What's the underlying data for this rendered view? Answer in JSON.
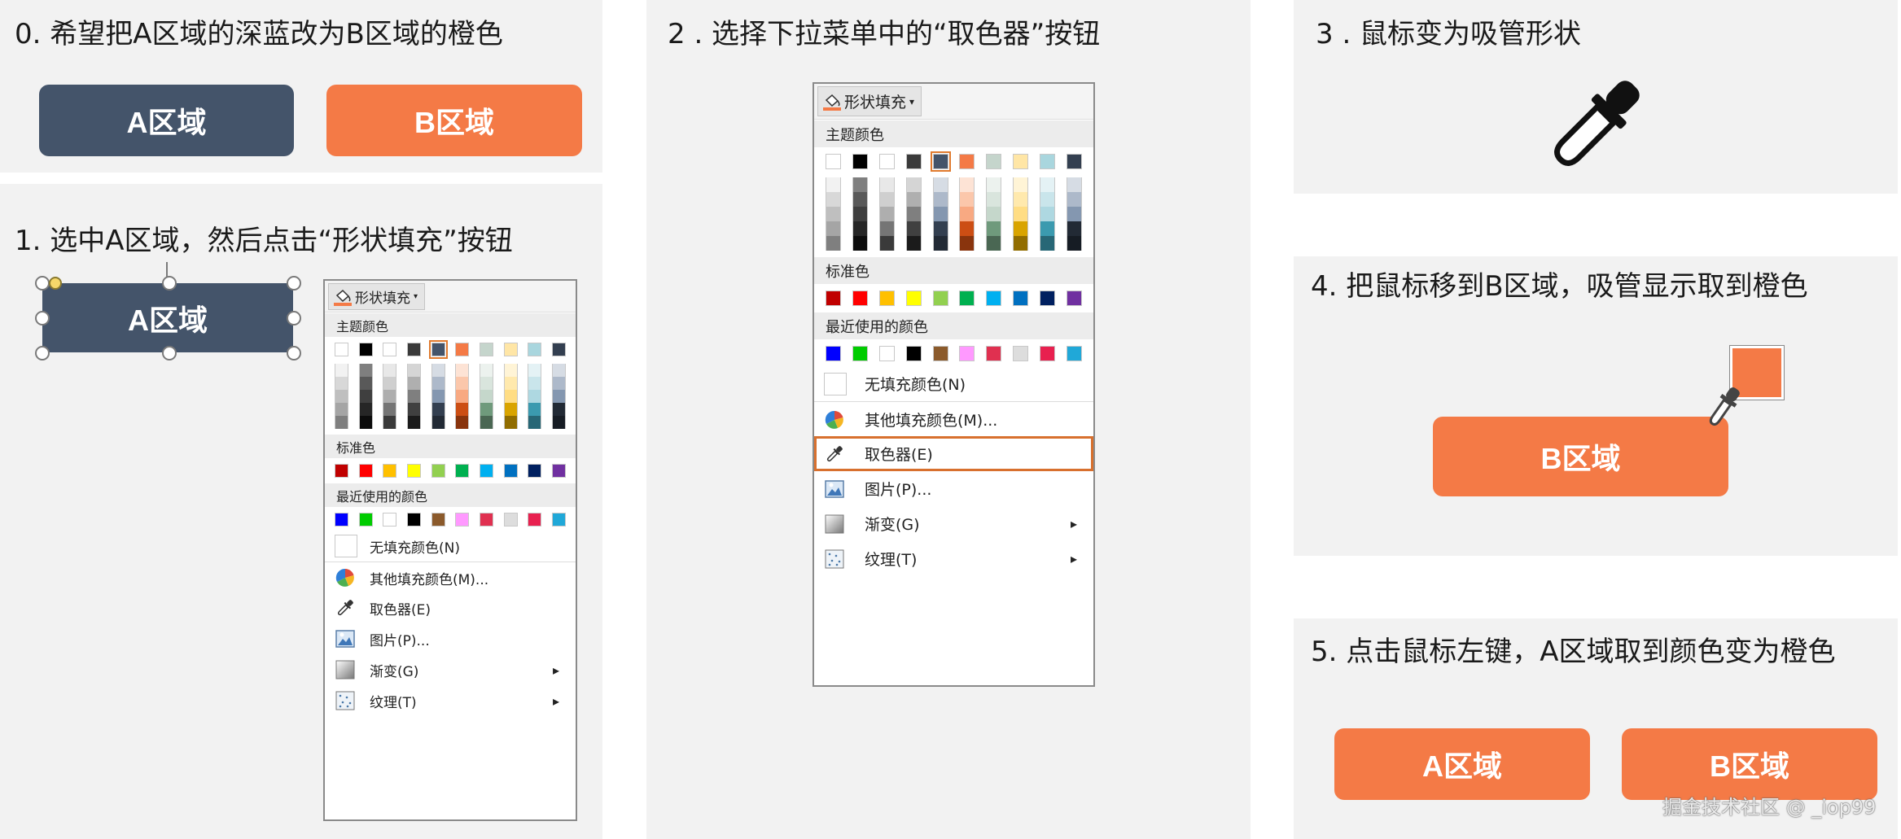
{
  "steps": {
    "s0": "0. 希望把A区域的深蓝改为B区域的橙色",
    "s1": "1. 选中A区域，然后点击“形状填充”按钮",
    "s2": "2 . 选择下拉菜单中的“取色器”按钮",
    "s3": "3 . 鼠标变为吸管形状",
    "s4": "4. 把鼠标移到B区域，吸管显示取到橙色",
    "s5": "5. 点击鼠标左键，A区域取到颜色变为橙色"
  },
  "shapes": {
    "a_label": "A区域",
    "b_label": "B区域"
  },
  "menu": {
    "button_label": "形状填充",
    "theme_colors_header": "主题颜色",
    "standard_colors_header": "标准色",
    "recent_colors_header": "最近使用的颜色",
    "no_fill": "无填充颜色(N)",
    "more_colors": "其他填充颜色(M)...",
    "eyedropper": "取色器(E)",
    "picture": "图片(P)...",
    "gradient": "渐变(G)",
    "texture": "纹理(T)",
    "theme_top": [
      "#ffffff",
      "#000000",
      "#ffffff",
      "#3a3a3a",
      "#44546a",
      "#f47a46",
      "#c5d5cc",
      "#ffe6a6",
      "#a9d6de",
      "#333f50"
    ],
    "theme_shades": [
      [
        "#f2f2f2",
        "#d8d8d8",
        "#bfbfbf",
        "#a5a5a5",
        "#7f7f7f"
      ],
      [
        "#7f7f7f",
        "#595959",
        "#3f3f3f",
        "#262626",
        "#0c0c0c"
      ],
      [
        "#e8e8e8",
        "#cfcfcf",
        "#aeaeae",
        "#757575",
        "#3a3a3a"
      ],
      [
        "#d5d5d5",
        "#afafaf",
        "#7f7f7f",
        "#404040",
        "#1b1b1b"
      ],
      [
        "#d6dce4",
        "#adb9ca",
        "#8497b0",
        "#333f50",
        "#222a35"
      ],
      [
        "#fde3d5",
        "#fbc7ab",
        "#f8a982",
        "#cc4e14",
        "#89340d"
      ],
      [
        "#ecf2ee",
        "#d9e5dd",
        "#c5d7cb",
        "#6f9a7c",
        "#4a6753"
      ],
      [
        "#fff4d6",
        "#ffe9ad",
        "#ffdd84",
        "#d9a400",
        "#916d00"
      ],
      [
        "#e4f2f5",
        "#c9e5eb",
        "#aed8e1",
        "#3b9aaf",
        "#276776"
      ],
      [
        "#d6dce4",
        "#adb9ca",
        "#8497b0",
        "#222a35",
        "#161c24"
      ]
    ],
    "standard": [
      "#c00000",
      "#ff0000",
      "#ffc000",
      "#ffff00",
      "#92d050",
      "#00b050",
      "#00b0f0",
      "#0070c0",
      "#002060",
      "#7030a0"
    ],
    "recent": [
      "#0000ff",
      "#00cc00",
      "#ffffff",
      "#000000",
      "#8b5a2b",
      "#ff99ff",
      "#e03050",
      "#dddddd",
      "#e8204f",
      "#20a8d8"
    ]
  },
  "watermark": "掘金技术社区 @ _iop99",
  "colors": {
    "navy": "#44546a",
    "orange": "#f47a46",
    "panel": "#f2f2f2",
    "highlight": "#d8702e"
  }
}
